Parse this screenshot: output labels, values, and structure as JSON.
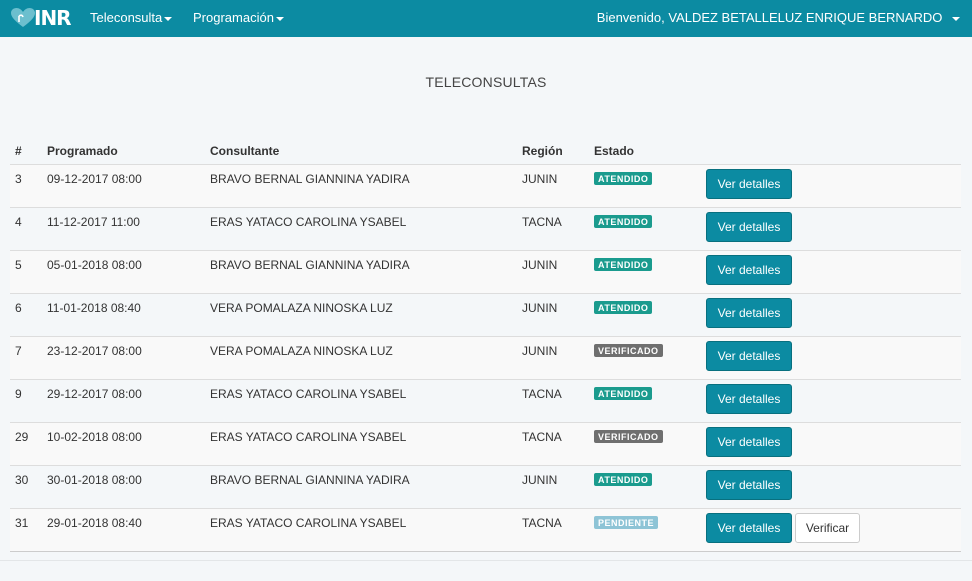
{
  "navbar": {
    "logo_text": "INR",
    "menu": [
      {
        "label": "Teleconsulta"
      },
      {
        "label": "Programación"
      }
    ],
    "user_greeting": "Bienvenido, VALDEZ BETALLELUZ ENRIQUE BERNARDO"
  },
  "page": {
    "title": "TELECONSULTAS"
  },
  "table": {
    "headers": [
      "#",
      "Programado",
      "Consultante",
      "Región",
      "Estado",
      ""
    ],
    "rows": [
      {
        "id": "3",
        "programado": "09-12-2017 08:00",
        "consultante": "BRAVO BERNAL GIANNINA YADIRA",
        "region": "JUNIN",
        "estado": "ATENDIDO",
        "estado_color": "#1a9b8e",
        "detalles": "Ver detalles",
        "verificar": ""
      },
      {
        "id": "4",
        "programado": "11-12-2017 11:00",
        "consultante": "ERAS YATACO CAROLINA YSABEL",
        "region": "TACNA",
        "estado": "ATENDIDO",
        "estado_color": "#1a9b8e",
        "detalles": "Ver detalles",
        "verificar": ""
      },
      {
        "id": "5",
        "programado": "05-01-2018 08:00",
        "consultante": "BRAVO BERNAL GIANNINA YADIRA",
        "region": "JUNIN",
        "estado": "ATENDIDO",
        "estado_color": "#1a9b8e",
        "detalles": "Ver detalles",
        "verificar": ""
      },
      {
        "id": "6",
        "programado": "11-01-2018 08:40",
        "consultante": "VERA POMALAZA NINOSKA LUZ",
        "region": "JUNIN",
        "estado": "ATENDIDO",
        "estado_color": "#1a9b8e",
        "detalles": "Ver detalles",
        "verificar": ""
      },
      {
        "id": "7",
        "programado": "23-12-2017 08:00",
        "consultante": "VERA POMALAZA NINOSKA LUZ",
        "region": "JUNIN",
        "estado": "VERIFICADO",
        "estado_color": "#6f6f6f",
        "detalles": "Ver detalles",
        "verificar": ""
      },
      {
        "id": "9",
        "programado": "29-12-2017 08:00",
        "consultante": "ERAS YATACO CAROLINA YSABEL",
        "region": "TACNA",
        "estado": "ATENDIDO",
        "estado_color": "#1a9b8e",
        "detalles": "Ver detalles",
        "verificar": ""
      },
      {
        "id": "29",
        "programado": "10-02-2018 08:00",
        "consultante": "ERAS YATACO CAROLINA YSABEL",
        "region": "TACNA",
        "estado": "VERIFICADO",
        "estado_color": "#6f6f6f",
        "detalles": "Ver detalles",
        "verificar": ""
      },
      {
        "id": "30",
        "programado": "30-01-2018 08:00",
        "consultante": "BRAVO BERNAL GIANNINA YADIRA",
        "region": "JUNIN",
        "estado": "ATENDIDO",
        "estado_color": "#1a9b8e",
        "detalles": "Ver detalles",
        "verificar": ""
      },
      {
        "id": "31",
        "programado": "29-01-2018 08:40",
        "consultante": "ERAS YATACO CAROLINA YSABEL",
        "region": "TACNA",
        "estado": "PENDIENTE",
        "estado_color": "#8ec4d6",
        "detalles": "Ver detalles",
        "verificar": "Verificar"
      }
    ]
  },
  "colors": {
    "navbar": "#0c8ba2",
    "primary_button": "#0c8ba2",
    "status_atendido": "#1a9b8e",
    "status_verificado": "#6f6f6f",
    "status_pendiente": "#8ec4d6"
  }
}
